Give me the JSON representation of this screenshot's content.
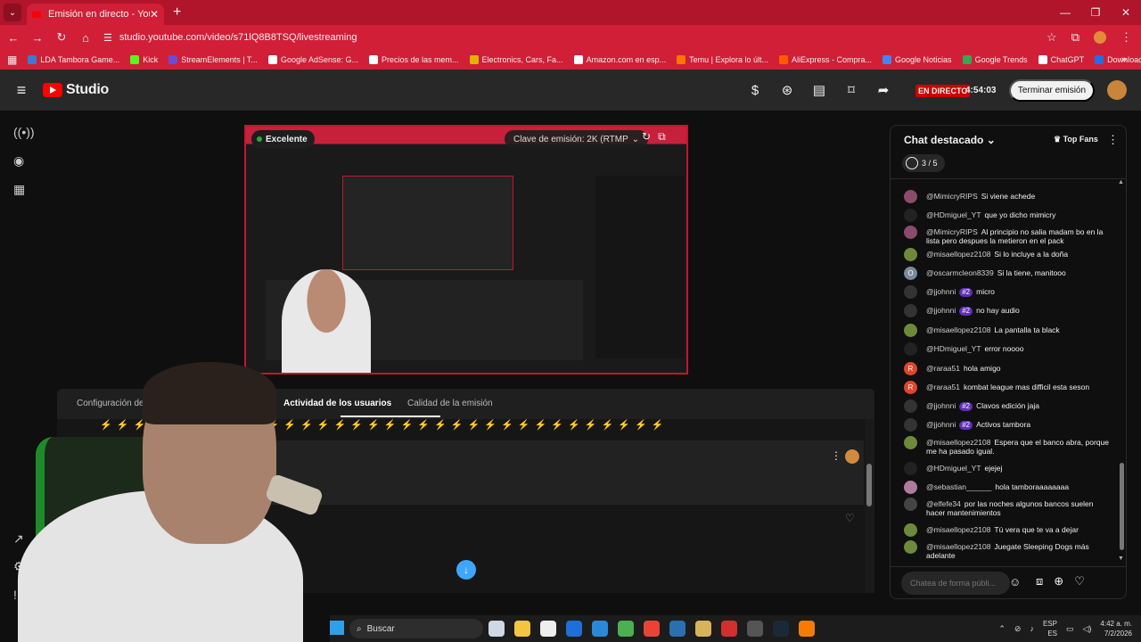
{
  "browser": {
    "tab_title": "Emisión en directo - YouTube S",
    "url": "studio.youtube.com/video/s71lQ8B8TSQ/livestreaming",
    "bookmarks": [
      {
        "label": "LDA Tambora Game...",
        "color": "#3a7bd5"
      },
      {
        "label": "Kick",
        "color": "#53fc18"
      },
      {
        "label": "StreamElements | T...",
        "color": "#6b4bd8"
      },
      {
        "label": "Google AdSense: G...",
        "color": "#ffffff"
      },
      {
        "label": "Precios de las mem...",
        "color": "#ffffff"
      },
      {
        "label": "Electronics, Cars, Fa...",
        "color": "#e0b400"
      },
      {
        "label": "Amazon.com en esp...",
        "color": "#ffffff"
      },
      {
        "label": "Temu | Explora lo últ...",
        "color": "#fb7701"
      },
      {
        "label": "AliExpress - Compra...",
        "color": "#ff5a00"
      },
      {
        "label": "Google Noticias",
        "color": "#4285f4"
      },
      {
        "label": "Google Trends",
        "color": "#34a853"
      },
      {
        "label": "ChatGPT",
        "color": "#ffffff"
      },
      {
        "label": "Download ROMs FR...",
        "color": "#1f6feb"
      }
    ]
  },
  "studio": {
    "logo_text": "Studio",
    "live_badge": "EN DIRECTO",
    "live_time": "4:54:03",
    "end_button": "Terminar emisión"
  },
  "preview": {
    "quality": "Excelente",
    "stream_key": "Clave de emisión: 2K (RTMP"
  },
  "tabs": [
    {
      "label": "Configuración de l",
      "active": false
    },
    {
      "label": "Actividad de los usuarios",
      "active": true
    },
    {
      "label": "Calidad de la emisión",
      "active": false
    }
  ],
  "chat": {
    "title": "Chat destacado",
    "top_fans": "Top Fans",
    "poll_count": "3 / 5",
    "input_placeholder": "Chatea de forma públi...",
    "messages": [
      {
        "author": "@MimicryRIPS",
        "text": "Si viene achede",
        "badge": "",
        "color": "#8a4c6a",
        "initial": ""
      },
      {
        "author": "@HDmiguel_YT",
        "text": "que yo dicho mimicry",
        "badge": "",
        "color": "#222222",
        "initial": ""
      },
      {
        "author": "@MimicryRIPS",
        "text": "Al principio no salia madam bo en la lista pero despues la metieron en el pack",
        "badge": "",
        "color": "#8a4c6a",
        "initial": ""
      },
      {
        "author": "@misaellopez2108",
        "text": "Si lo incluye a la doña",
        "badge": "",
        "color": "#6d8a3a",
        "initial": ""
      },
      {
        "author": "@oscarmcleon8339",
        "text": "Si la tiene, manitooo",
        "badge": "",
        "color": "#7a8a99",
        "initial": "O"
      },
      {
        "author": "@jjohnni",
        "text": "micro",
        "badge": "#2",
        "color": "#333333",
        "initial": ""
      },
      {
        "author": "@jjohnni",
        "text": "no hay audio",
        "badge": "#2",
        "color": "#333333",
        "initial": ""
      },
      {
        "author": "@misaellopez2108",
        "text": "La pantalla ta black",
        "badge": "",
        "color": "#6d8a3a",
        "initial": ""
      },
      {
        "author": "@HDmiguel_YT",
        "text": "error noooo",
        "badge": "",
        "color": "#222222",
        "initial": ""
      },
      {
        "author": "@raraa51",
        "text": "hola amigo",
        "badge": "",
        "color": "#e0452b",
        "initial": "R"
      },
      {
        "author": "@raraa51",
        "text": "kombat league mas difficil esta seson",
        "badge": "",
        "color": "#e0452b",
        "initial": "R"
      },
      {
        "author": "@jjohnni",
        "text": "Clavos edición jaja",
        "badge": "#2",
        "color": "#333333",
        "initial": ""
      },
      {
        "author": "@jjohnni",
        "text": "Activos tambora",
        "badge": "#2",
        "color": "#333333",
        "initial": ""
      },
      {
        "author": "@misaellopez2108",
        "text": "Espera que el banco abra, porque me ha pasado igual.",
        "badge": "",
        "color": "#6d8a3a",
        "initial": ""
      },
      {
        "author": "@HDmiguel_YT",
        "text": "ejejej",
        "badge": "",
        "color": "#222222",
        "initial": ""
      },
      {
        "author": "@sebastian______",
        "text": "hola tamboraaaaaaaa",
        "badge": "",
        "color": "#b07a9a",
        "initial": ""
      },
      {
        "author": "@elfefe34",
        "text": "por las noches algunos bancos suelen hacer mantenimientos",
        "badge": "",
        "color": "#444444",
        "initial": ""
      },
      {
        "author": "@misaellopez2108",
        "text": "Tú vera que te va a dejar",
        "badge": "",
        "color": "#6d8a3a",
        "initial": ""
      },
      {
        "author": "@misaellopez2108",
        "text": "Juegate Sleeping Dogs más adelante",
        "badge": "",
        "color": "#6d8a3a",
        "initial": ""
      }
    ]
  },
  "taskbar": {
    "search_label": "Buscar",
    "lang_top": "ESP",
    "lang_bottom": "ES",
    "time": "4:42 a. m.",
    "date": "7/2/2026"
  },
  "icons": {
    "hamburger": "menu-icon",
    "rail": [
      "broadcast-icon",
      "camera-icon",
      "calendar-icon",
      "external-link-icon",
      "settings-icon",
      "feedback-icon"
    ]
  }
}
